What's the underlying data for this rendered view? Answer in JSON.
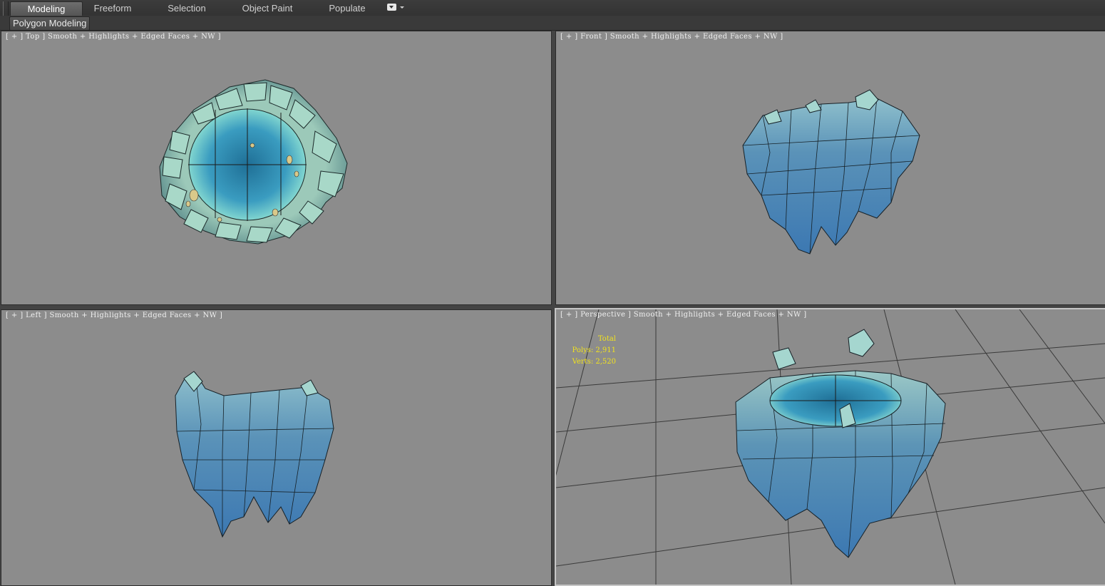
{
  "ribbon": {
    "tabs": [
      {
        "label": "Modeling",
        "active": true
      },
      {
        "label": "Freeform",
        "active": false
      },
      {
        "label": "Selection",
        "active": false
      },
      {
        "label": "Object Paint",
        "active": false
      },
      {
        "label": "Populate",
        "active": false
      }
    ],
    "panel_button": "Polygon Modeling",
    "dropdown_icon": "chevron-down-icon"
  },
  "viewports": {
    "top": {
      "label": "[ + ] Top ] Smooth + Highlights + Edged Faces + NW ]"
    },
    "front": {
      "label": "[ + ] Front ] Smooth + Highlights + Edged Faces + NW ]"
    },
    "left": {
      "label": "[ + ] Left ] Smooth + Highlights + Edged Faces + NW ]"
    },
    "perspective": {
      "label": "[ + ] Perspective ] Smooth + Highlights + Edged Faces + NW ]",
      "active": true
    }
  },
  "stats": {
    "title": "Total",
    "polys": "Polys: 2,911",
    "verts": "Verts: 2,520"
  },
  "colors": {
    "viewport_bg": "#8c8c8c",
    "stats_text": "#f1e21e",
    "model_rock": "#4d86b0",
    "model_top": "#9fd0c4",
    "model_water": "#2f8db3"
  }
}
